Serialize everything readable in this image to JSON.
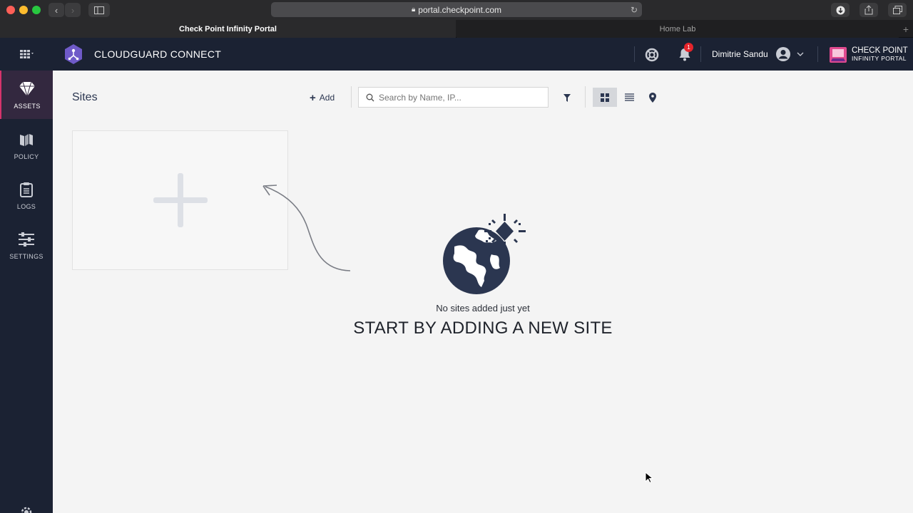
{
  "browser": {
    "url": "portal.checkpoint.com",
    "tabs": [
      {
        "label": "Check Point Infinity Portal",
        "active": true
      },
      {
        "label": "Home Lab",
        "active": false
      }
    ]
  },
  "header": {
    "product_name": "CLOUDGUARD CONNECT",
    "user_name": "Dimitrie Sandu",
    "notification_count": "1",
    "brand_line1": "CHECK POINT",
    "brand_line2": "INFINITY PORTAL"
  },
  "sidebar": {
    "items": [
      {
        "label": "ASSETS",
        "icon": "diamond-icon",
        "active": true
      },
      {
        "label": "POLICY",
        "icon": "map-icon",
        "active": false
      },
      {
        "label": "LOGS",
        "icon": "clipboard-icon",
        "active": false
      },
      {
        "label": "SETTINGS",
        "icon": "sliders-icon",
        "active": false
      }
    ]
  },
  "main": {
    "page_title": "Sites",
    "add_label": "Add",
    "search_placeholder": "Search by Name, IP...",
    "empty_message": "No sites added just yet",
    "empty_cta": "START BY ADDING A NEW SITE"
  },
  "colors": {
    "header_bg": "#1b2233",
    "accent": "#d6336c",
    "badge": "#e5242b",
    "globe": "#2b3650"
  }
}
